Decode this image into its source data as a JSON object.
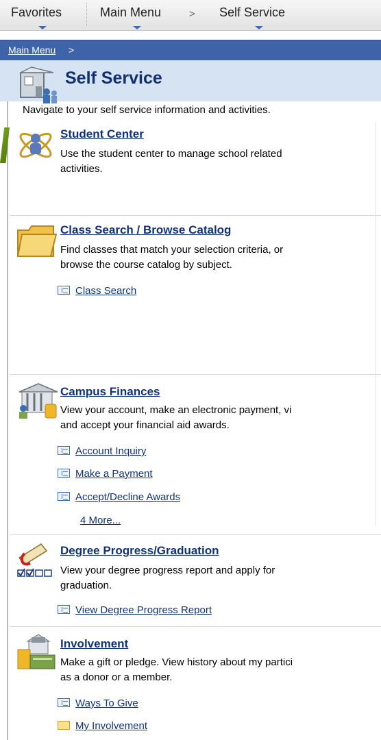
{
  "nav": {
    "favorites": "Favorites",
    "main_menu": "Main Menu",
    "separator": ">",
    "self_service": "Self Service"
  },
  "breadcrumb": {
    "main_menu": "Main Menu",
    "separator": ">"
  },
  "page": {
    "title": "Self Service",
    "description": "Navigate to your self service information and activities."
  },
  "sections": [
    {
      "title": "Student Center",
      "description": "Use the student center to manage school related\nactivities.",
      "icon": "student-center-icon",
      "links": []
    },
    {
      "title": "Class Search / Browse Catalog",
      "description": "Find classes that match your selection criteria, or\nbrowse the course catalog by subject.",
      "icon": "folder-icon",
      "links": [
        "Class Search"
      ]
    },
    {
      "title": "Campus Finances",
      "description": "View your account, make an electronic payment, vi\nand accept your financial aid awards.",
      "icon": "bank-icon",
      "links": [
        "Account Inquiry",
        "Make a Payment",
        "Accept/Decline Awards"
      ],
      "more": "4 More..."
    },
    {
      "title": "Degree Progress/Graduation",
      "description": "View your degree progress report and apply for\ngraduation.",
      "icon": "diploma-icon",
      "links": [
        "View Degree Progress Report"
      ]
    },
    {
      "title": "Involvement",
      "description": "Make a gift or pledge. View history about my partici\nas a donor or a member.",
      "icon": "involvement-icon",
      "links": [
        "Ways To Give",
        "My Involvement"
      ]
    }
  ],
  "colors": {
    "breadcrumb_bar": "#3f63a8",
    "title_band": "#d6e3f2",
    "link": "#11317a",
    "title": "#10306e"
  }
}
